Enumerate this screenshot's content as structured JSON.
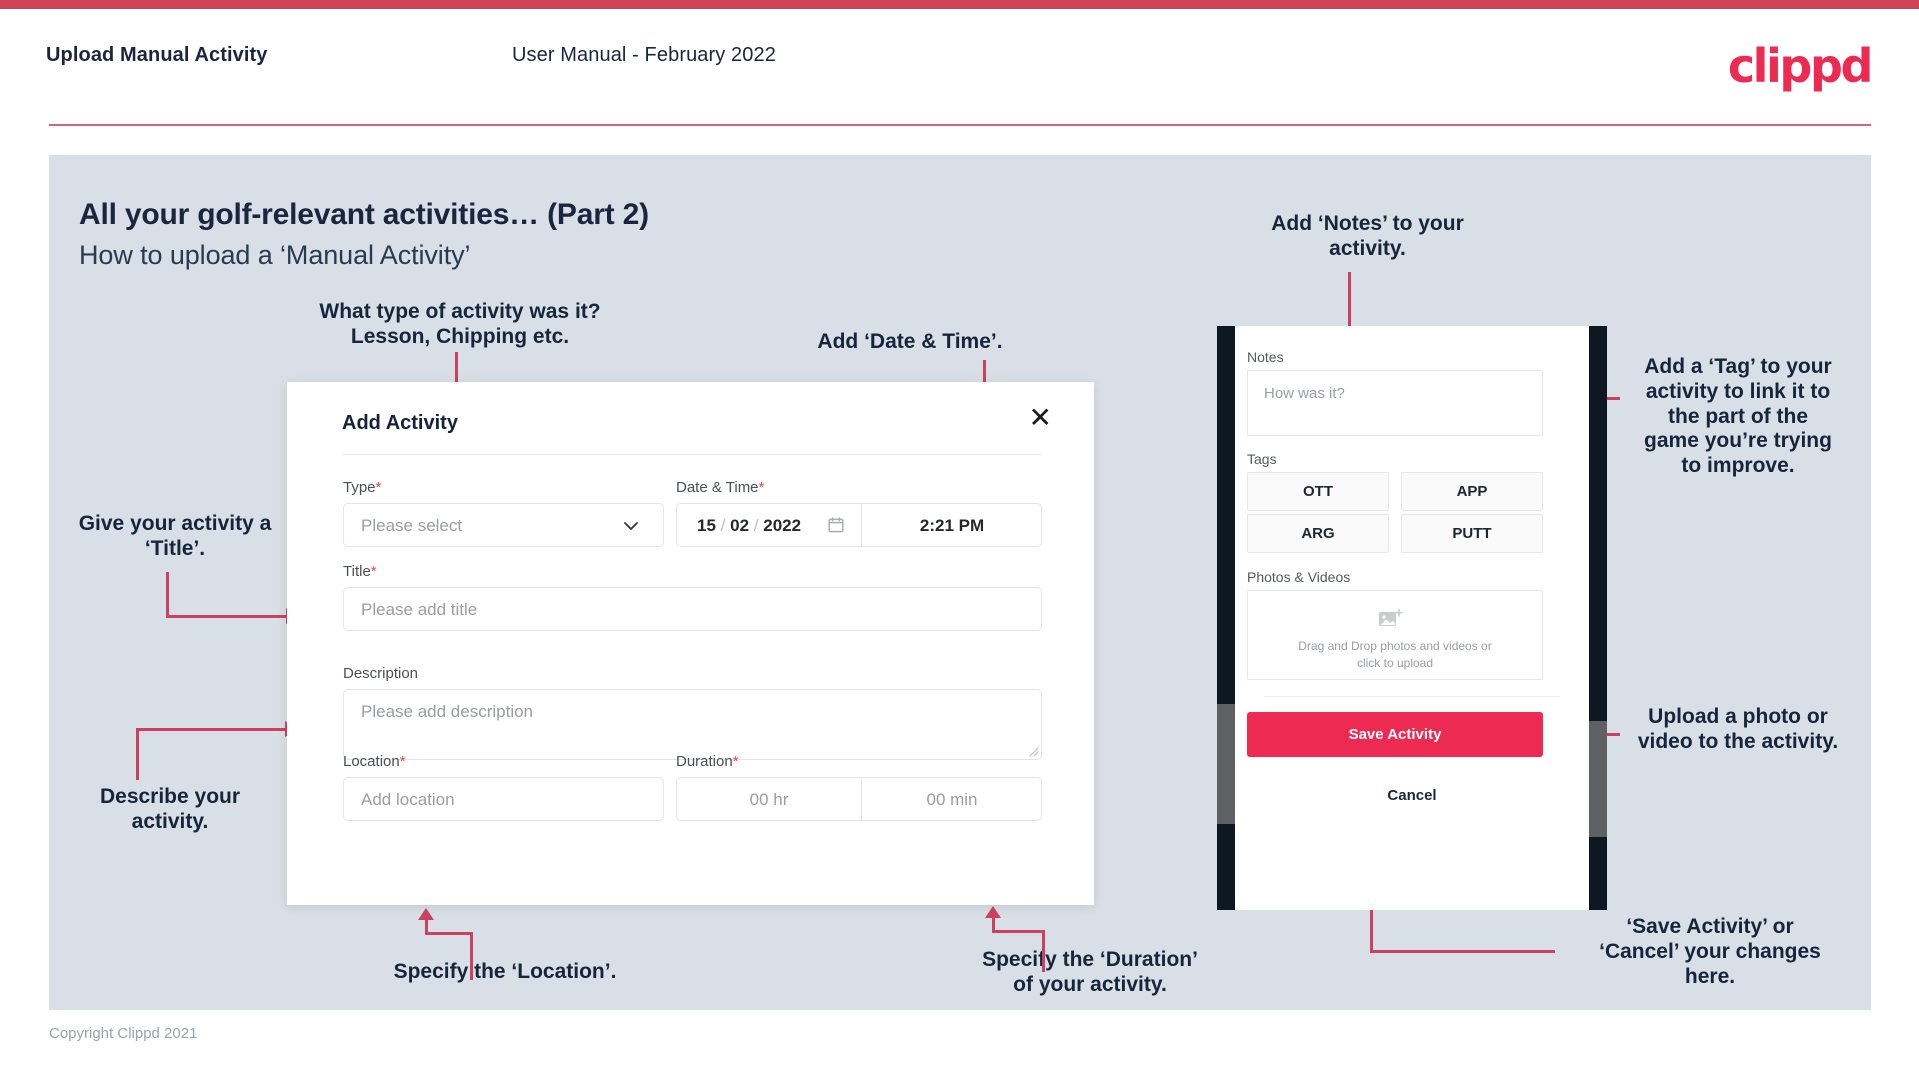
{
  "header": {
    "title": "Upload Manual Activity",
    "subtitle": "User Manual - February 2022",
    "brand": "clippd"
  },
  "slide": {
    "title": "All your golf-relevant activities… (Part 2)",
    "subtitle": "How to upload a ‘Manual Activity’"
  },
  "footer": {
    "copyright": "Copyright Clippd 2021"
  },
  "annotations": {
    "type": "What type of activity was it?\nLesson, Chipping etc.",
    "datetime": "Add ‘Date & Time’.",
    "title": "Give your activity a\n‘Title’.",
    "description": "Describe your\nactivity.",
    "location": "Specify the ‘Location’.",
    "duration": "Specify the ‘Duration’\nof your activity.",
    "notes": "Add ‘Notes’ to your\nactivity.",
    "tags": "Add a ‘Tag’ to your\nactivity to link it to\nthe part of the\ngame you’re trying\nto improve.",
    "upload": "Upload a photo or\nvideo to the activity.",
    "save": "‘Save Activity’ or\n‘Cancel’ your changes\nhere."
  },
  "dialog": {
    "title": "Add Activity",
    "close_label": "✕",
    "fields": {
      "type": {
        "label": "Type",
        "required": "*",
        "placeholder": "Please select"
      },
      "datetime": {
        "label": "Date & Time",
        "required": "*",
        "day": "15",
        "month": "02",
        "year": "2022",
        "sep": "/",
        "time": "2:21 PM"
      },
      "title": {
        "label": "Title",
        "required": "*",
        "placeholder": "Please add title"
      },
      "description": {
        "label": "Description",
        "required": "",
        "placeholder": "Please add description"
      },
      "location": {
        "label": "Location",
        "required": "*",
        "placeholder": "Add location"
      },
      "duration": {
        "label": "Duration",
        "required": "*",
        "hours": "00 hr",
        "minutes": "00 min"
      }
    }
  },
  "phone": {
    "notes": {
      "label": "Notes",
      "placeholder": "How was it?"
    },
    "tags": {
      "label": "Tags",
      "items": [
        "OTT",
        "APP",
        "ARG",
        "PUTT"
      ]
    },
    "photos": {
      "label": "Photos & Videos",
      "hint": "Drag and Drop photos and videos or\nclick to upload"
    },
    "save_label": "Save Activity",
    "cancel_label": "Cancel"
  },
  "colors": {
    "brand_pink": "#ec2a52",
    "strip_red": "#cf4257",
    "annotation_line": "#cc4160",
    "slide_bg": "#d8dfe6",
    "text_dark": "#16243c",
    "required_star": "#f0453a"
  }
}
